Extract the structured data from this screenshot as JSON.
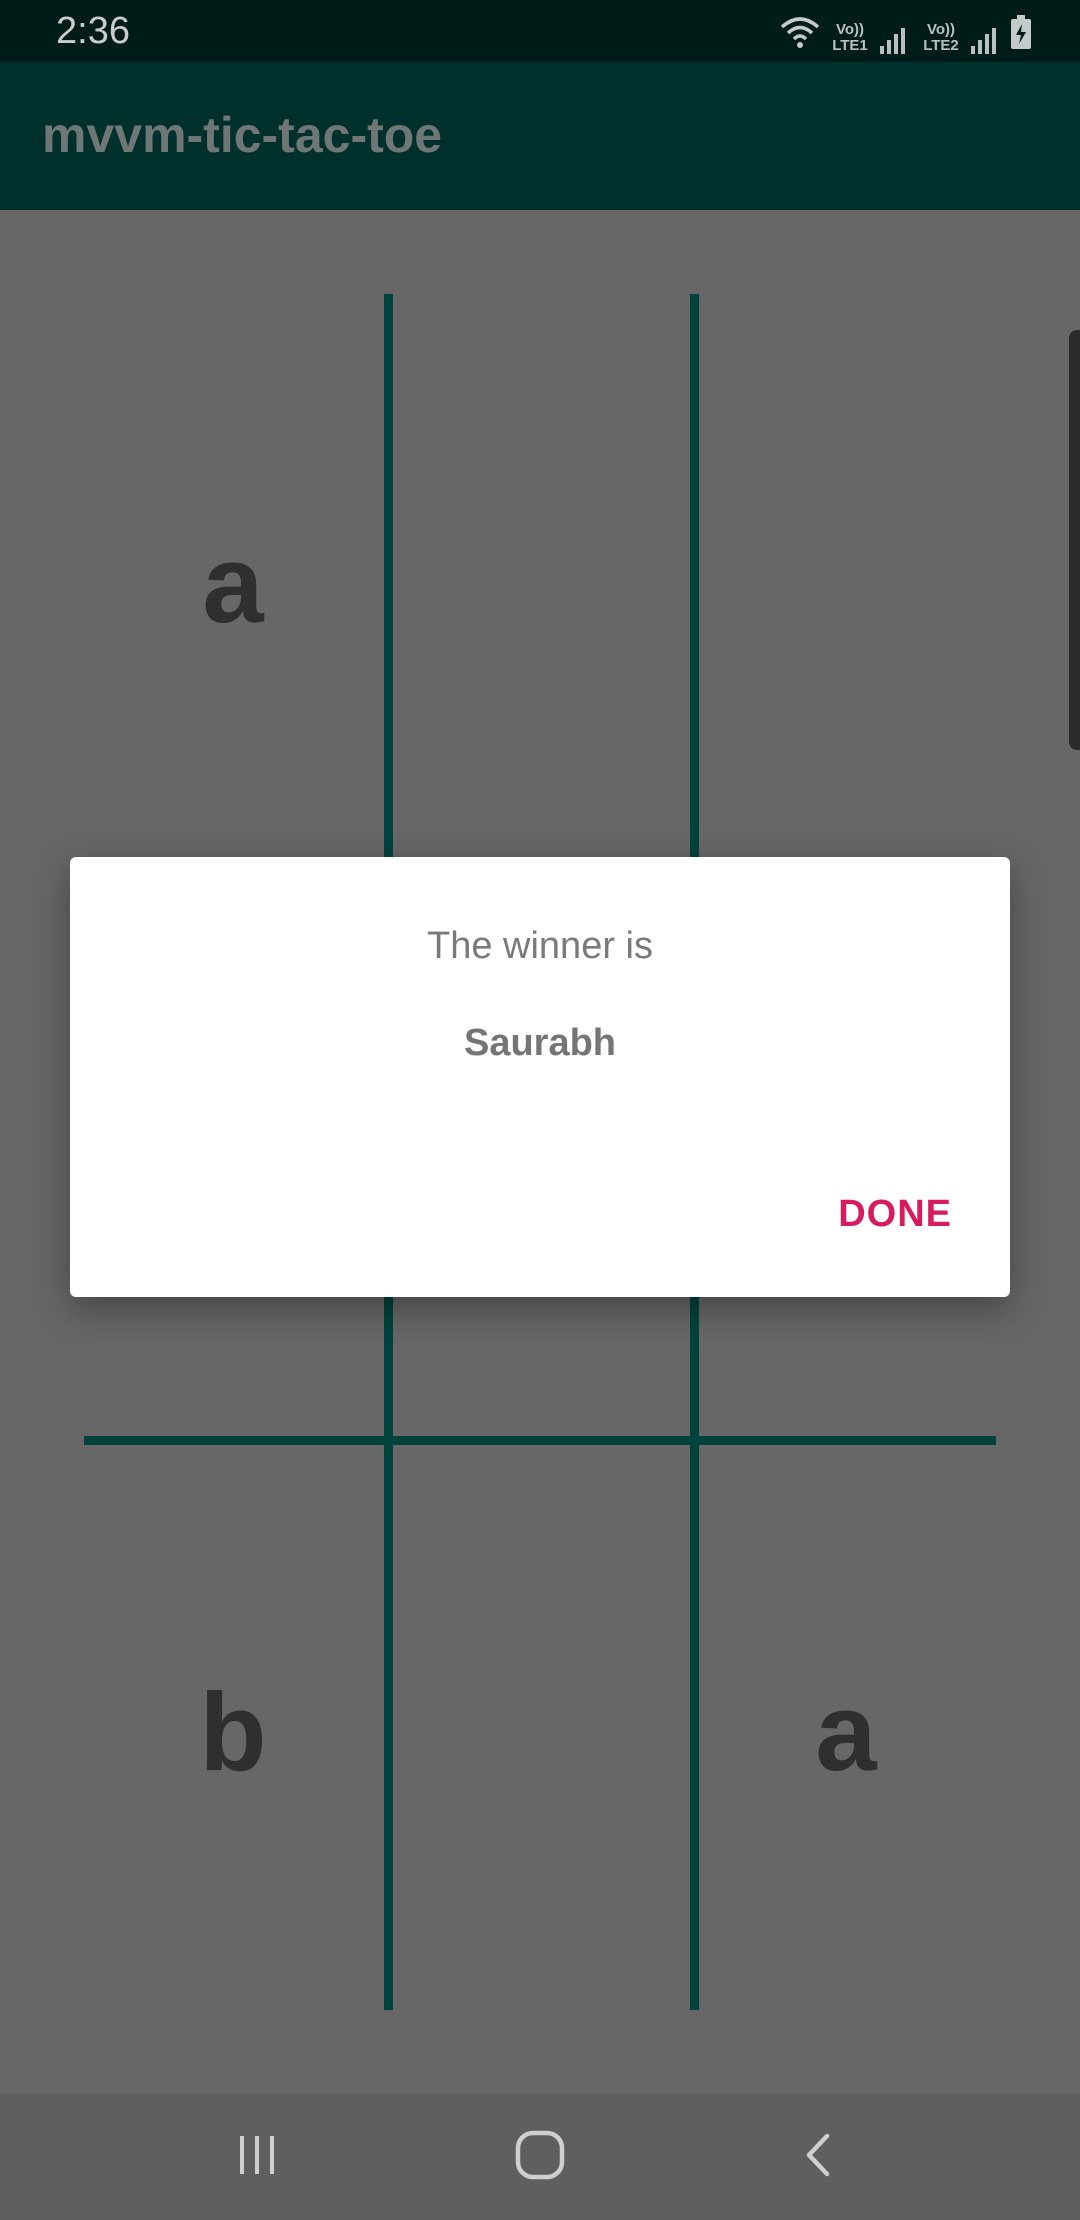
{
  "status_bar": {
    "time": "2:36",
    "sim1_label": "Vo)) LTE1",
    "sim2_label": "Vo)) LTE2",
    "icons": [
      "wifi-icon",
      "signal-icon",
      "signal-icon",
      "battery-charging-icon"
    ]
  },
  "app_bar": {
    "title": "mvvm-tic-tac-toe"
  },
  "board": {
    "cells": [
      [
        "a",
        "",
        ""
      ],
      [
        "",
        "",
        ""
      ],
      [
        "b",
        "",
        "a"
      ]
    ]
  },
  "dialog": {
    "title": "The winner is",
    "winner": "Saurabh",
    "done_label": "DONE"
  },
  "nav_bar": {
    "icons": [
      "recent-apps-icon",
      "home-icon",
      "back-icon"
    ]
  },
  "colors": {
    "status_bar": "#001c19",
    "app_bar": "#00302b",
    "grid_line": "#00433d",
    "scrim": "#676767",
    "accent": "#d81b60"
  }
}
